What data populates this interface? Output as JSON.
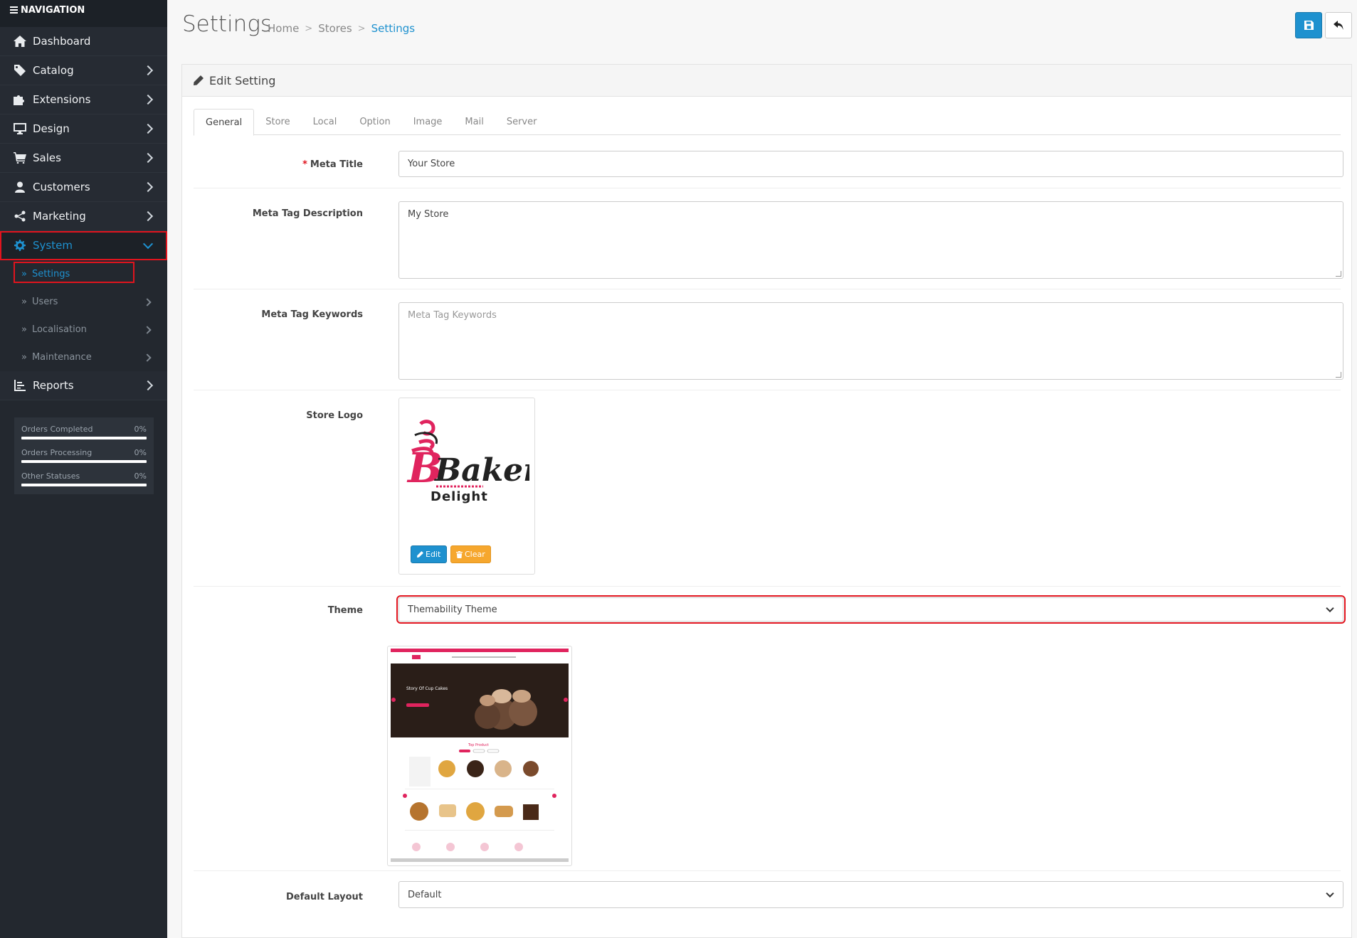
{
  "sidebar": {
    "nav_title": "NAVIGATION",
    "items": [
      {
        "label": "Dashboard"
      },
      {
        "label": "Catalog"
      },
      {
        "label": "Extensions"
      },
      {
        "label": "Design"
      },
      {
        "label": "Sales"
      },
      {
        "label": "Customers"
      },
      {
        "label": "Marketing"
      },
      {
        "label": "System"
      }
    ],
    "system_sub": [
      {
        "label": "Settings"
      },
      {
        "label": "Users"
      },
      {
        "label": "Localisation"
      },
      {
        "label": "Maintenance"
      }
    ],
    "reports_label": "Reports",
    "stats": [
      {
        "label": "Orders Completed",
        "value": "0%"
      },
      {
        "label": "Orders Processing",
        "value": "0%"
      },
      {
        "label": "Other Statuses",
        "value": "0%"
      }
    ]
  },
  "header": {
    "title": "Settings",
    "breadcrumb": [
      "Home",
      "Stores",
      "Settings"
    ]
  },
  "panel": {
    "heading": "Edit Setting",
    "tabs": [
      "General",
      "Store",
      "Local",
      "Option",
      "Image",
      "Mail",
      "Server"
    ]
  },
  "form": {
    "meta_title": {
      "label": "Meta Title",
      "value": "Your Store"
    },
    "meta_desc": {
      "label": "Meta Tag Description",
      "value": "My Store"
    },
    "meta_keywords": {
      "label": "Meta Tag Keywords",
      "placeholder": "Meta Tag Keywords"
    },
    "store_logo": {
      "label": "Store Logo",
      "edit_label": "Edit",
      "clear_label": "Clear",
      "logo_word": "Bakery",
      "logo_sub": "Delight"
    },
    "theme": {
      "label": "Theme",
      "value": "Themability Theme"
    },
    "default_layout": {
      "label": "Default Layout",
      "value": "Default"
    }
  },
  "theme_preview": {
    "hero_title": "Story Of Cup Cakes",
    "section_title": "Top Product"
  },
  "colors": {
    "accent": "#1e91cf",
    "sidebar_bg": "#23282f",
    "highlight": "#e0141e",
    "logo_pink": "#e0245e"
  }
}
